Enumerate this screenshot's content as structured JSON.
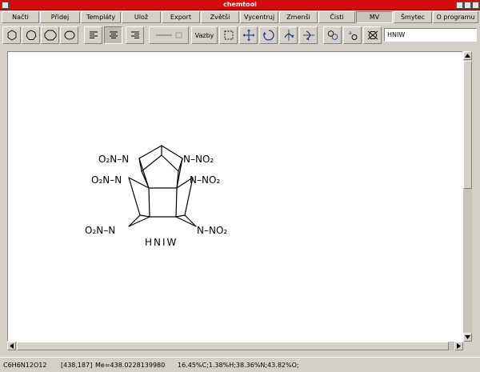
{
  "window": {
    "title": "chemtool"
  },
  "menu": {
    "items": [
      "Načti",
      "Přidej",
      "Templáty",
      "Ulož",
      "Export",
      "Zvětši",
      "Vycentruj",
      "Zmenši",
      "Čisti",
      "MV",
      "Šmytec",
      "O programu"
    ]
  },
  "toolbar": {
    "bonds_label": "Vazby",
    "name_value": "HNIW",
    "icons": [
      "hexagon-icon",
      "heptagon-icon",
      "octagon-icon",
      "octagon-small-icon",
      "align-left-icon",
      "align-center-icon",
      "align-right-icon",
      "bond-dash-icon",
      "bonds-menu",
      "select-rect-icon",
      "move-icon",
      "rotate-icon",
      "flip-horizontal-icon",
      "flip-vertical-icon",
      "copy-icon",
      "paste-icon",
      "erase-icon"
    ]
  },
  "molecule": {
    "labels": {
      "no2_top_left": "O₂N–N",
      "no2_mid_left": "O₂N–N",
      "no2_bottom_left": "O₂N–N",
      "no2_top_right": "N–NO₂",
      "no2_mid_right": "N–NO₂",
      "no2_bottom_right": "N–NO₂",
      "name": "HNIW"
    }
  },
  "status": {
    "formula": "C6H6N12O12",
    "coords": "[438,187]",
    "mass": "Me=438.0228139980",
    "composition": "16.45%C;1.38%H;38.36%N;43.82%O;"
  }
}
